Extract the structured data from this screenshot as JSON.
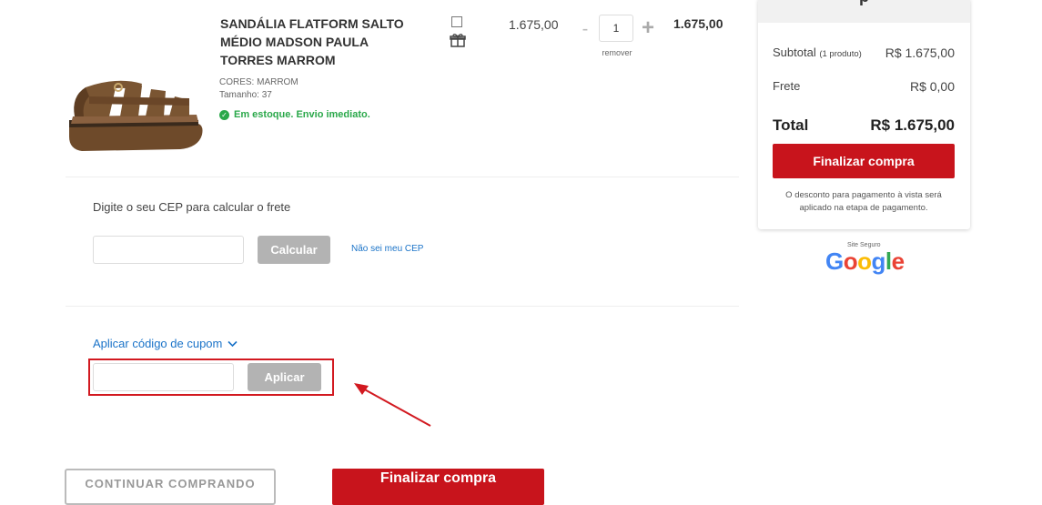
{
  "product": {
    "name": "SANDÁLIA FLATFORM SALTO MÉDIO MADSON PAULA TORRES MARROM",
    "color": "CORES: MARROM",
    "size": "Tamanho: 37",
    "stock": "Em estoque. Envio imediato.",
    "unit_price": "1.675,00",
    "quantity": "1",
    "minus": "-",
    "plus": "+",
    "remove": "remover",
    "line_total": "1.675,00",
    "image_color": "#7a5532"
  },
  "shipping": {
    "label": "Digite o seu CEP para calcular o frete",
    "cep_value": "",
    "calculate_label": "Calcular",
    "unknown_cep_link": "Não sei meu CEP"
  },
  "coupon": {
    "toggle_label": "Aplicar código de cupom",
    "code_value": "",
    "apply_label": "Aplicar"
  },
  "summary": {
    "header_partial": "p",
    "subtotal_label": "Subtotal",
    "subtotal_count": "(1 produto)",
    "subtotal_value": "R$ 1.675,00",
    "shipping_label": "Frete",
    "shipping_value": "R$ 0,00",
    "total_label": "Total",
    "total_value": "R$ 1.675,00",
    "checkout_label": "Finalizar compra",
    "disclaimer": "O desconto para pagamento à vista será aplicado na etapa de pagamento."
  },
  "badge": {
    "small_text": "Site Seguro",
    "word": "Google",
    "colors": [
      "#4285F4",
      "#EA4335",
      "#FBBC05",
      "#4285F4",
      "#34A853",
      "#EA4335"
    ]
  },
  "bottom": {
    "continue_label": "CONTINUAR COMPRANDO",
    "finish_label": "Finalizar compra"
  },
  "colors": {
    "accent_red": "#c8141c",
    "link_blue": "#1a73c8",
    "stock_green": "#2aa84a",
    "annotation_red": "#d21920"
  }
}
